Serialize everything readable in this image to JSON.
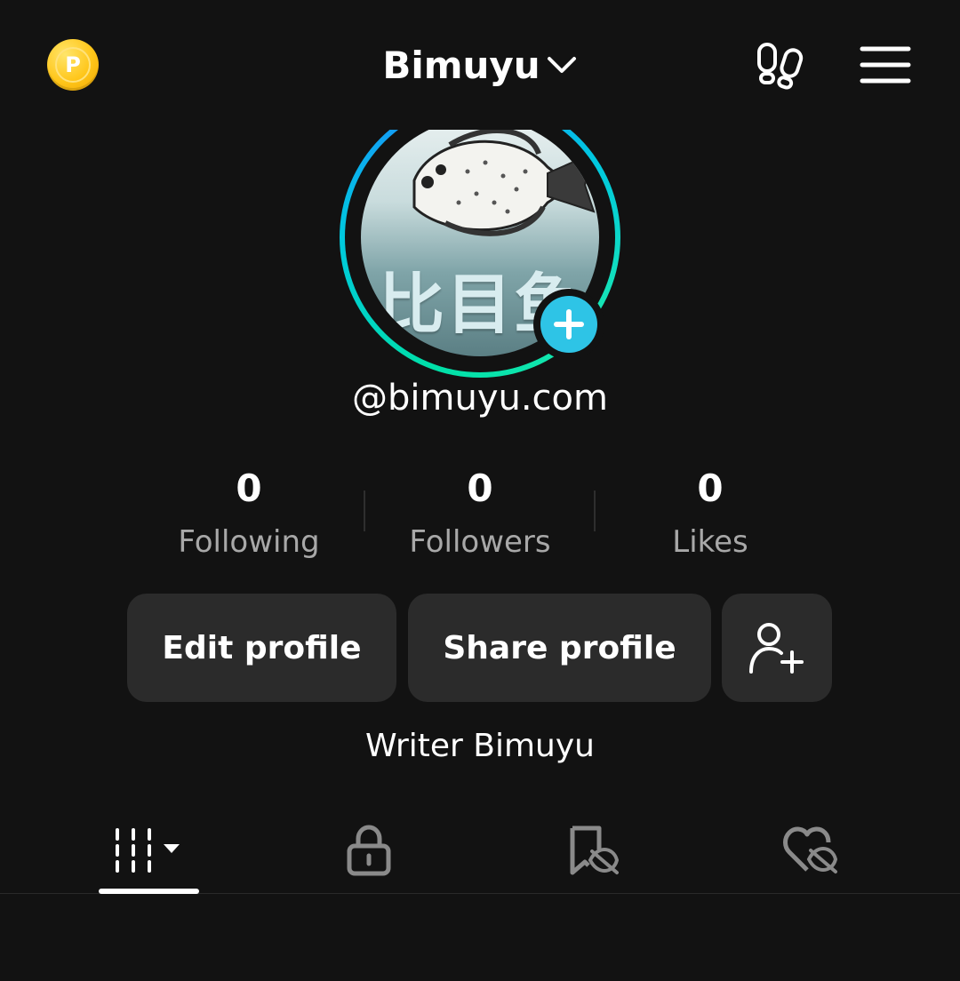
{
  "header": {
    "coin_letter": "P",
    "username": "Bimuyu",
    "icons": [
      "coin-icon",
      "chevron-down-icon",
      "footprints-icon",
      "menu-icon"
    ]
  },
  "profile": {
    "avatar_text": "比目鱼",
    "handle": "@bimuyu.com",
    "bio": "Writer Bimuyu"
  },
  "stats": [
    {
      "value": "0",
      "label": "Following"
    },
    {
      "value": "0",
      "label": "Followers"
    },
    {
      "value": "0",
      "label": "Likes"
    }
  ],
  "actions": {
    "edit_label": "Edit profile",
    "share_label": "Share profile",
    "add_friend_icon": "add-user-icon"
  },
  "tabs": {
    "items": [
      "videos-grid-icon",
      "lock-icon",
      "bookmark-hidden-icon",
      "heart-hidden-icon"
    ],
    "active": 0
  },
  "colors": {
    "background": "#121212",
    "button": "#2b2b2b",
    "accent": "#2ec4e6",
    "muted_text": "#a8a8a8",
    "coin": "#ffc61a"
  }
}
